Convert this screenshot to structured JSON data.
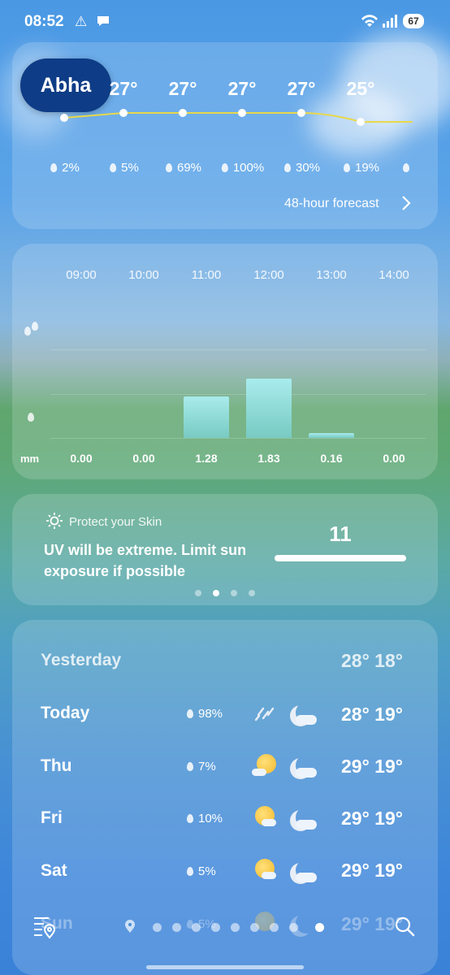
{
  "status_bar": {
    "time": "08:52",
    "battery": "67"
  },
  "location": {
    "city": "Abha"
  },
  "hourly": {
    "temps": [
      "27°",
      "27°",
      "27°",
      "27°",
      "25°"
    ],
    "precip": [
      "2%",
      "5%",
      "69%",
      "100%",
      "30%",
      "19%"
    ],
    "forecast_link": "48-hour forecast"
  },
  "rain_chart": {
    "unit": "mm",
    "hours": [
      "09:00",
      "10:00",
      "11:00",
      "12:00",
      "13:00",
      "14:00"
    ],
    "amounts": [
      "0.00",
      "0.00",
      "1.28",
      "1.83",
      "0.16",
      "0.00"
    ]
  },
  "chart_data": {
    "type": "bar",
    "categories": [
      "09:00",
      "10:00",
      "11:00",
      "12:00",
      "13:00",
      "14:00"
    ],
    "values": [
      0.0,
      0.0,
      1.28,
      1.83,
      0.16,
      0.0
    ],
    "ylabel": "mm"
  },
  "uv": {
    "title": "Protect your Skin",
    "message": "UV will be extreme. Limit sun exposure if possible",
    "index": "11",
    "pages": 4,
    "active_page": 1
  },
  "daily": [
    {
      "day": "Yesterday",
      "precip": "",
      "temps": "28° 18°",
      "day_icon": "",
      "night_icon": ""
    },
    {
      "day": "Today",
      "precip": "98%",
      "temps": "28° 19°",
      "day_icon": "rain-icon",
      "night_icon": "cloudy-night-icon"
    },
    {
      "day": "Thu",
      "precip": "7%",
      "temps": "29° 19°",
      "day_icon": "partly-sunny-icon",
      "night_icon": "cloudy-night-icon"
    },
    {
      "day": "Fri",
      "precip": "10%",
      "temps": "29° 19°",
      "day_icon": "partly-sunny-icon",
      "night_icon": "cloudy-night-icon"
    },
    {
      "day": "Sat",
      "precip": "5%",
      "temps": "29° 19°",
      "day_icon": "partly-sunny-icon",
      "night_icon": "cloudy-night-icon"
    },
    {
      "day": "Sun",
      "precip": "5%",
      "temps": "29° 19°",
      "day_icon": "partly-sunny-icon",
      "night_icon": "cloudy-night-icon"
    }
  ],
  "nav": {
    "page_count": 9,
    "active_page": 8
  },
  "colors": {
    "city_pill": "#0e3c86",
    "temp_line": "#e8d84a",
    "rain_bar": "#a8ecef"
  }
}
